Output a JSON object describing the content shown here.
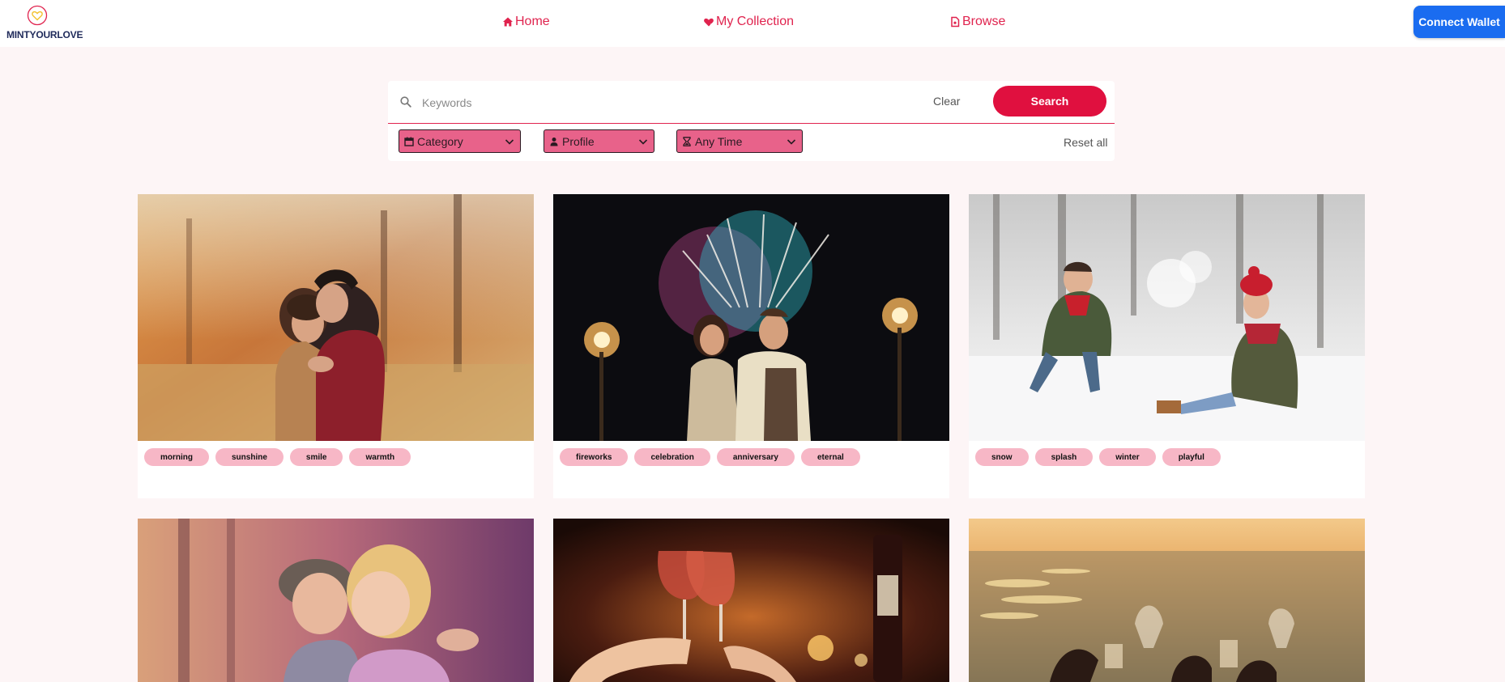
{
  "brand": {
    "name": "MINTYOURLOVE",
    "accent": "#e0234e",
    "primary_blue": "#1a6cf0"
  },
  "nav": {
    "items": [
      {
        "label": "Home",
        "icon": "home-icon"
      },
      {
        "label": "My Collection",
        "icon": "heart-icon"
      },
      {
        "label": "Browse",
        "icon": "document-icon"
      }
    ],
    "connect_label": "Connect Wallet"
  },
  "search": {
    "placeholder": "Keywords",
    "value": "",
    "clear_label": "Clear",
    "search_label": "Search",
    "reset_label": "Reset all",
    "filters": [
      {
        "label": "Category",
        "icon": "calendar-icon"
      },
      {
        "label": "Profile",
        "icon": "person-icon"
      },
      {
        "label": "Any Time",
        "icon": "hourglass-icon"
      }
    ]
  },
  "cards": [
    {
      "photo": "couple-autumn-photo",
      "tags": [
        "morning",
        "sunshine",
        "smile",
        "warmth"
      ]
    },
    {
      "photo": "couple-fireworks-photo",
      "tags": [
        "fireworks",
        "celebration",
        "anniversary",
        "eternal"
      ]
    },
    {
      "photo": "couple-snow-photo",
      "tags": [
        "snow",
        "splash",
        "winter",
        "playful"
      ]
    },
    {
      "photo": "children-kiss-photo",
      "tags": []
    },
    {
      "photo": "wine-toast-photo",
      "tags": []
    },
    {
      "photo": "beach-dinner-photo",
      "tags": []
    }
  ]
}
